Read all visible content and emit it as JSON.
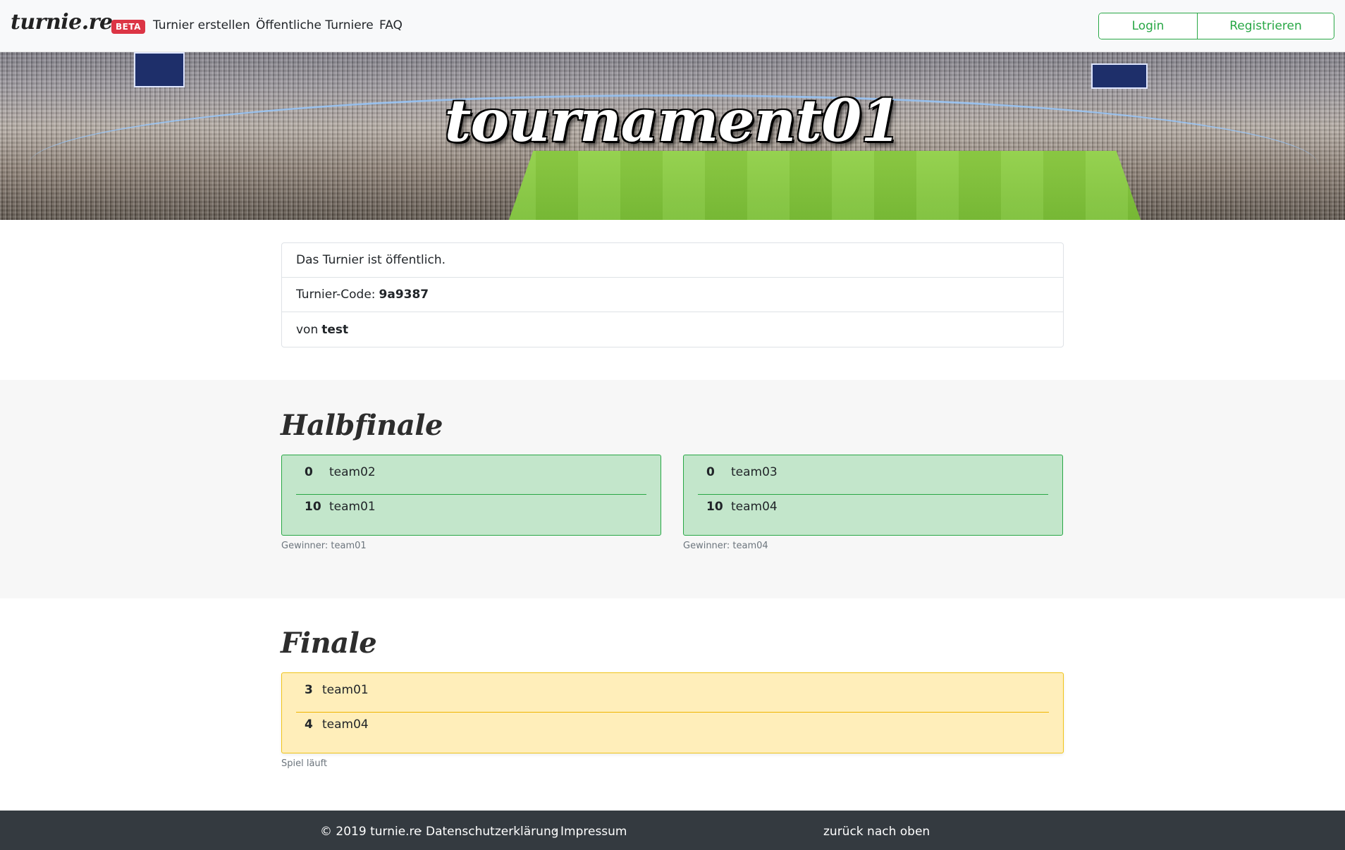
{
  "navbar": {
    "brand": "turnie.re",
    "badge": "BETA",
    "links": [
      "Turnier erstellen",
      "Öffentliche Turniere",
      "FAQ"
    ],
    "login_label": "Login",
    "register_label": "Registrieren"
  },
  "hero": {
    "title": "tournament01"
  },
  "info": {
    "public_text": "Das Turnier ist öffentlich.",
    "code_label": "Turnier-Code:",
    "code_value": "9a9387",
    "owner_label": "von",
    "owner_value": "test"
  },
  "halbfinale": {
    "title": "Halbfinale",
    "matches": [
      {
        "rows": [
          {
            "score": "0",
            "team": "team02"
          },
          {
            "score": "10",
            "team": "team01"
          }
        ],
        "note": "Gewinner: team01"
      },
      {
        "rows": [
          {
            "score": "0",
            "team": "team03"
          },
          {
            "score": "10",
            "team": "team04"
          }
        ],
        "note": "Gewinner: team04"
      }
    ]
  },
  "finale": {
    "title": "Finale",
    "match": {
      "rows": [
        {
          "score": "3",
          "team": "team01"
        },
        {
          "score": "4",
          "team": "team04"
        }
      ],
      "note": "Spiel läuft"
    }
  },
  "footer": {
    "copyright": "© 2019 turnie.re",
    "sep": "·",
    "privacy": "Datenschutzerklärung",
    "imprint": "Impressum",
    "back_to_top": "zurück nach oben"
  },
  "colors": {
    "accent_green": "#28a745",
    "match_done_bg": "#c3e6cb",
    "match_live_bg": "#ffeeba",
    "badge_red": "#dc3545",
    "footer_bg": "#343a40"
  }
}
